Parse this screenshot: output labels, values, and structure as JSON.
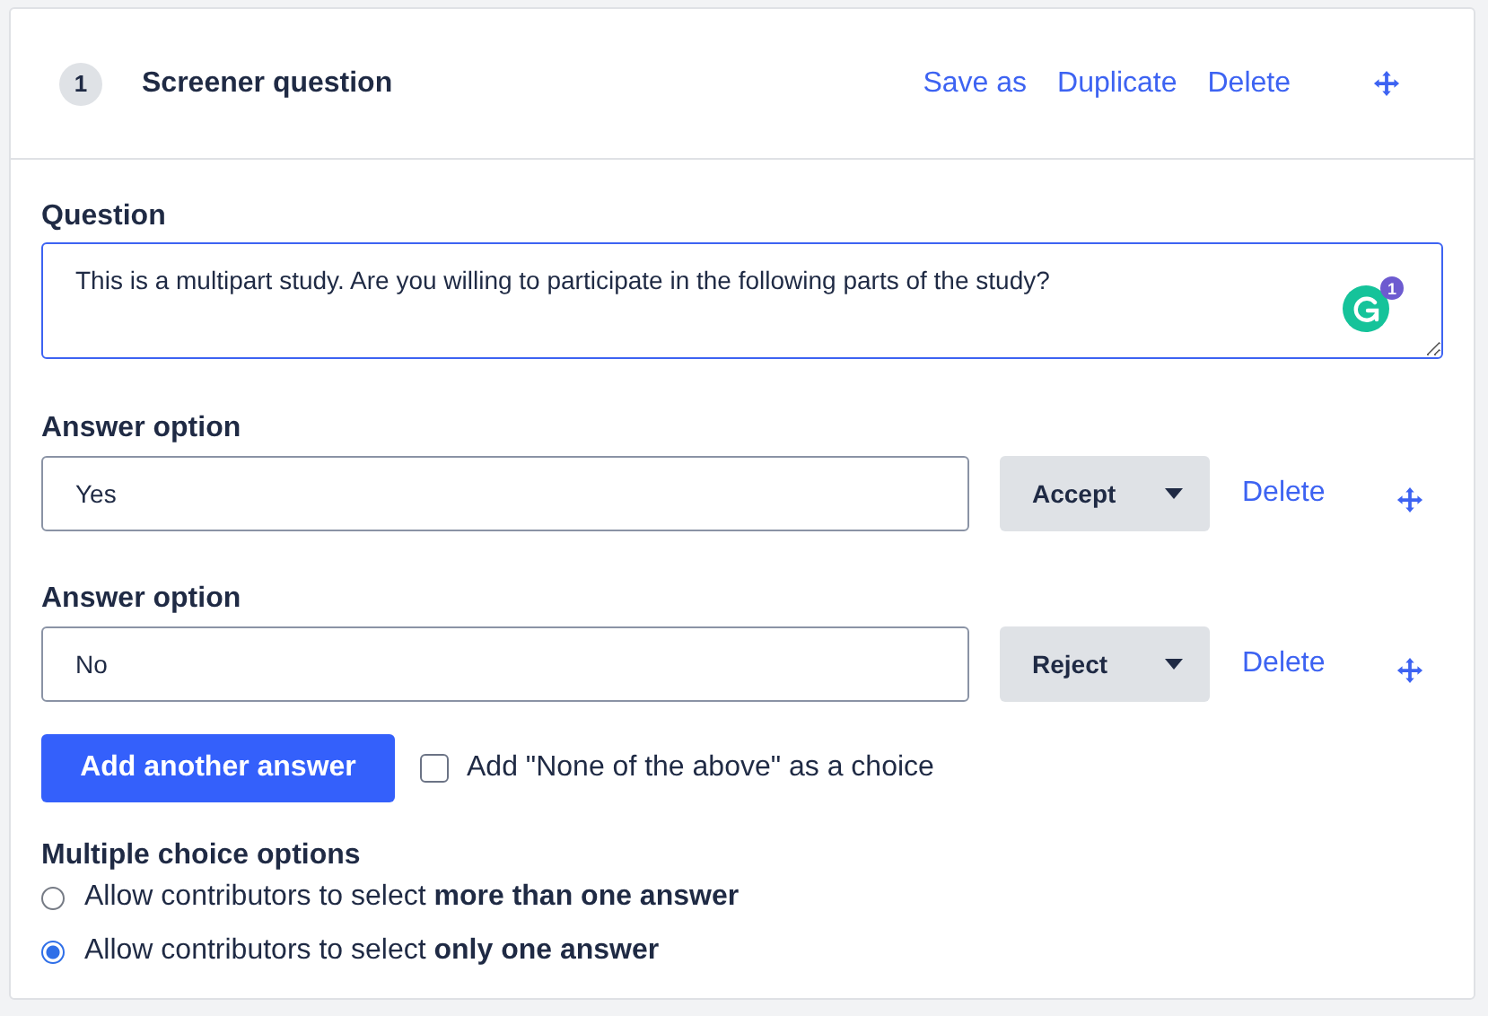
{
  "header": {
    "number": "1",
    "title": "Screener question",
    "actions": [
      "Save as",
      "Duplicate",
      "Delete"
    ]
  },
  "question": {
    "label": "Question",
    "value": "This is a multipart study. Are you willing to participate in the following parts of the study?",
    "grammarly_count": "1"
  },
  "answers": [
    {
      "label": "Answer option",
      "value": "Yes",
      "status": "Accept",
      "delete": "Delete"
    },
    {
      "label": "Answer option",
      "value": "No",
      "status": "Reject",
      "delete": "Delete"
    }
  ],
  "add_button": "Add another answer",
  "none_choice": {
    "label": "Add \"None of the above\" as a choice",
    "checked": false
  },
  "multiple_choice": {
    "title": "Multiple choice options",
    "options": [
      {
        "text": "Allow contributors to select **more than one answer**",
        "selected": false
      },
      {
        "text": "Allow contributors to select **only one answer**",
        "selected": true
      }
    ]
  }
}
